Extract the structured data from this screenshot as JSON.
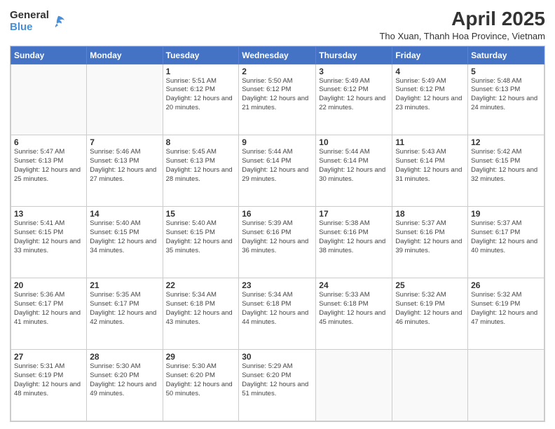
{
  "header": {
    "logo_general": "General",
    "logo_blue": "Blue",
    "month_year": "April 2025",
    "subtitle": "Tho Xuan, Thanh Hoa Province, Vietnam"
  },
  "days_of_week": [
    "Sunday",
    "Monday",
    "Tuesday",
    "Wednesday",
    "Thursday",
    "Friday",
    "Saturday"
  ],
  "weeks": [
    [
      {
        "day": "",
        "info": ""
      },
      {
        "day": "",
        "info": ""
      },
      {
        "day": "1",
        "info": "Sunrise: 5:51 AM\nSunset: 6:12 PM\nDaylight: 12 hours and 20 minutes."
      },
      {
        "day": "2",
        "info": "Sunrise: 5:50 AM\nSunset: 6:12 PM\nDaylight: 12 hours and 21 minutes."
      },
      {
        "day": "3",
        "info": "Sunrise: 5:49 AM\nSunset: 6:12 PM\nDaylight: 12 hours and 22 minutes."
      },
      {
        "day": "4",
        "info": "Sunrise: 5:49 AM\nSunset: 6:12 PM\nDaylight: 12 hours and 23 minutes."
      },
      {
        "day": "5",
        "info": "Sunrise: 5:48 AM\nSunset: 6:13 PM\nDaylight: 12 hours and 24 minutes."
      }
    ],
    [
      {
        "day": "6",
        "info": "Sunrise: 5:47 AM\nSunset: 6:13 PM\nDaylight: 12 hours and 25 minutes."
      },
      {
        "day": "7",
        "info": "Sunrise: 5:46 AM\nSunset: 6:13 PM\nDaylight: 12 hours and 27 minutes."
      },
      {
        "day": "8",
        "info": "Sunrise: 5:45 AM\nSunset: 6:13 PM\nDaylight: 12 hours and 28 minutes."
      },
      {
        "day": "9",
        "info": "Sunrise: 5:44 AM\nSunset: 6:14 PM\nDaylight: 12 hours and 29 minutes."
      },
      {
        "day": "10",
        "info": "Sunrise: 5:44 AM\nSunset: 6:14 PM\nDaylight: 12 hours and 30 minutes."
      },
      {
        "day": "11",
        "info": "Sunrise: 5:43 AM\nSunset: 6:14 PM\nDaylight: 12 hours and 31 minutes."
      },
      {
        "day": "12",
        "info": "Sunrise: 5:42 AM\nSunset: 6:15 PM\nDaylight: 12 hours and 32 minutes."
      }
    ],
    [
      {
        "day": "13",
        "info": "Sunrise: 5:41 AM\nSunset: 6:15 PM\nDaylight: 12 hours and 33 minutes."
      },
      {
        "day": "14",
        "info": "Sunrise: 5:40 AM\nSunset: 6:15 PM\nDaylight: 12 hours and 34 minutes."
      },
      {
        "day": "15",
        "info": "Sunrise: 5:40 AM\nSunset: 6:15 PM\nDaylight: 12 hours and 35 minutes."
      },
      {
        "day": "16",
        "info": "Sunrise: 5:39 AM\nSunset: 6:16 PM\nDaylight: 12 hours and 36 minutes."
      },
      {
        "day": "17",
        "info": "Sunrise: 5:38 AM\nSunset: 6:16 PM\nDaylight: 12 hours and 38 minutes."
      },
      {
        "day": "18",
        "info": "Sunrise: 5:37 AM\nSunset: 6:16 PM\nDaylight: 12 hours and 39 minutes."
      },
      {
        "day": "19",
        "info": "Sunrise: 5:37 AM\nSunset: 6:17 PM\nDaylight: 12 hours and 40 minutes."
      }
    ],
    [
      {
        "day": "20",
        "info": "Sunrise: 5:36 AM\nSunset: 6:17 PM\nDaylight: 12 hours and 41 minutes."
      },
      {
        "day": "21",
        "info": "Sunrise: 5:35 AM\nSunset: 6:17 PM\nDaylight: 12 hours and 42 minutes."
      },
      {
        "day": "22",
        "info": "Sunrise: 5:34 AM\nSunset: 6:18 PM\nDaylight: 12 hours and 43 minutes."
      },
      {
        "day": "23",
        "info": "Sunrise: 5:34 AM\nSunset: 6:18 PM\nDaylight: 12 hours and 44 minutes."
      },
      {
        "day": "24",
        "info": "Sunrise: 5:33 AM\nSunset: 6:18 PM\nDaylight: 12 hours and 45 minutes."
      },
      {
        "day": "25",
        "info": "Sunrise: 5:32 AM\nSunset: 6:19 PM\nDaylight: 12 hours and 46 minutes."
      },
      {
        "day": "26",
        "info": "Sunrise: 5:32 AM\nSunset: 6:19 PM\nDaylight: 12 hours and 47 minutes."
      }
    ],
    [
      {
        "day": "27",
        "info": "Sunrise: 5:31 AM\nSunset: 6:19 PM\nDaylight: 12 hours and 48 minutes."
      },
      {
        "day": "28",
        "info": "Sunrise: 5:30 AM\nSunset: 6:20 PM\nDaylight: 12 hours and 49 minutes."
      },
      {
        "day": "29",
        "info": "Sunrise: 5:30 AM\nSunset: 6:20 PM\nDaylight: 12 hours and 50 minutes."
      },
      {
        "day": "30",
        "info": "Sunrise: 5:29 AM\nSunset: 6:20 PM\nDaylight: 12 hours and 51 minutes."
      },
      {
        "day": "",
        "info": ""
      },
      {
        "day": "",
        "info": ""
      },
      {
        "day": "",
        "info": ""
      }
    ]
  ]
}
